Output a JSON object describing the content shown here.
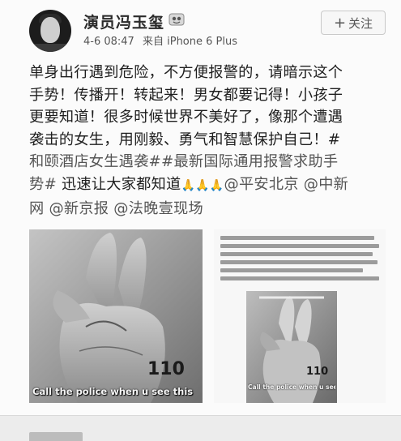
{
  "user": {
    "name": "演员冯玉玺",
    "date": "4-6 08:47",
    "source": "来自 iPhone 6 Plus",
    "follow_label": "关注"
  },
  "post": {
    "line1": "单身出行遇到危险，不方便报警的，请暗示这个",
    "line2": "手势！传播开！转起来！男女都要记得！小孩子",
    "line3": "更要知道！很多时候世界不美好了，像那个遭遇",
    "line4": "袭击的女生，用刚毅、勇气和智慧保护自己！#",
    "line5": "和颐酒店女生遇袭##最新国际通用报警求助手",
    "line6a": "势#",
    "line6b": " 迅速让大家都知道",
    "line6c": "🙏🙏🙏",
    "line6d": "@平安北京 @中新",
    "line7": "网 @新京报 @法晚壹现场"
  },
  "images": {
    "img1_number": "110",
    "img1_caption": "Call the police when u see this",
    "img2_number": "110",
    "img2_caption": "Call the police when u see this"
  },
  "colors": {
    "background": "#fbfbfb",
    "text": "#1f1f1f",
    "link": "#555555"
  }
}
